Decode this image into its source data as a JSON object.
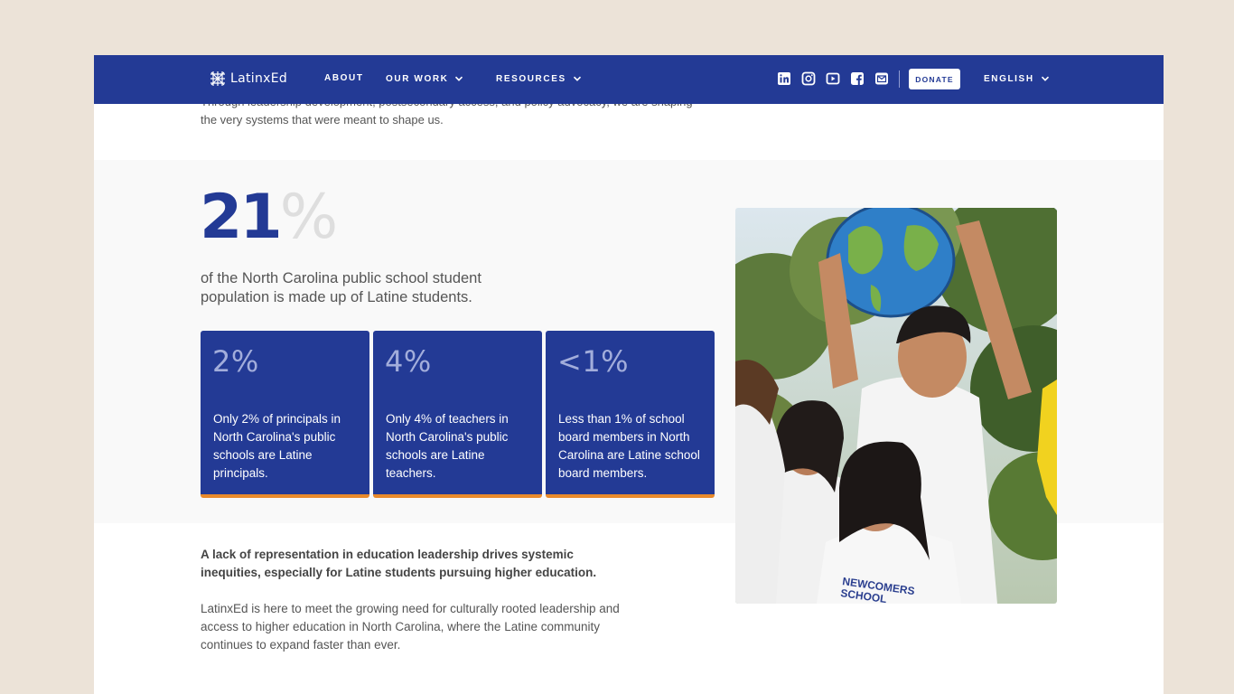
{
  "nav": {
    "logo_text": "LatinxEd",
    "items": [
      {
        "label": "ABOUT"
      },
      {
        "label": "OUR WORK"
      },
      {
        "label": "RESOURCES"
      }
    ],
    "donate_label": "DONATE",
    "language_label": "ENGLISH",
    "social_icons": [
      "linkedin-icon",
      "instagram-icon",
      "youtube-icon",
      "facebook-icon",
      "email-icon"
    ]
  },
  "intro": {
    "text": "Through leadership development, postsecondary access, and policy advocacy, we are shaping the very systems that were meant to shape us."
  },
  "stats": {
    "big_number": "21",
    "big_unit": "%",
    "big_description": "of the North Carolina public school student population is made up of Latine students.",
    "cards": [
      {
        "value": "2%",
        "text": "Only 2% of principals in North Carolina's public schools are Latine principals."
      },
      {
        "value": "4%",
        "text": "Only 4% of teachers in North Carolina's public schools are Latine teachers."
      },
      {
        "value": "<1%",
        "text": "Less than 1% of school board members in North Carolina are Latine school board members."
      }
    ]
  },
  "photo": {
    "shirt_text_line1": "NEWCOMERS",
    "shirt_text_line2": "SCHOOL"
  },
  "body": {
    "bold_paragraph": "A lack of representation in education leadership drives systemic inequities, especially for Latine students pursuing higher education.",
    "paragraph": "LatinxEd is here to meet the growing need for culturally rooted leadership and access to higher education in North Carolina, where the Latine community continues to expand faster than ever."
  },
  "colors": {
    "brand_blue": "#233a95",
    "accent_orange": "#e98a2b",
    "page_background": "#ece3d8"
  }
}
